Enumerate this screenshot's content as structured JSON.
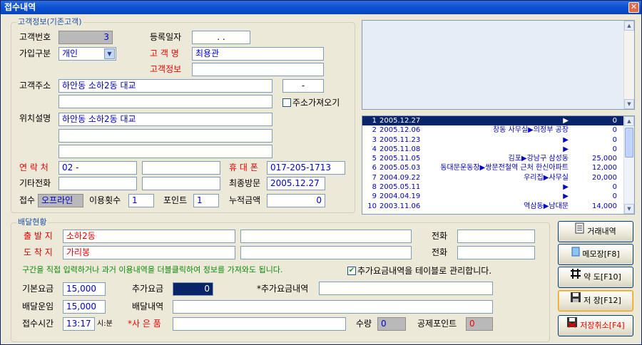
{
  "window": {
    "title": "접수내역",
    "close": "✕"
  },
  "customer": {
    "group_label": "고객정보(기존고객)",
    "id_label": "고객번호",
    "id_value": "3",
    "regdate_label": "등록일자",
    "regdate_value": ". .",
    "type_label": "가입구분",
    "type_value": "개인",
    "name_label": "고 객 명",
    "name_value": "최용관",
    "info_label": "고객정보",
    "info_value": "",
    "address_label": "고객주소",
    "address_value": "하안동 소하2동 대교",
    "zip_value": "-",
    "address2_value": "",
    "fetch_address_label": "주소가져오기",
    "location_label": "위치설명",
    "location_value": "하안동 소하2동 대교",
    "location2_value": "",
    "location3_value": "",
    "contact_label": "연 락 처",
    "contact_value": "02  -",
    "contact2_value": "",
    "mobile_label": "휴 대 폰",
    "mobile_value": "017-205-1713",
    "other_phone_label": "기타전화",
    "other_phone_value": "",
    "other_phone2_value": "",
    "last_visit_label": "최종방문",
    "last_visit_value": "2005.12.27",
    "intake_label": "접수",
    "intake_value": "오프라인",
    "use_count_label": "이용횟수",
    "use_count_value": "1",
    "points_label": "포인트",
    "points_value": "1",
    "total_label": "누적금액",
    "total_value": "0"
  },
  "memo": {
    "value": ""
  },
  "history": {
    "rows": [
      {
        "no": "1",
        "date": "2005.12.27",
        "route": "▶",
        "amount": "0",
        "selected": true
      },
      {
        "no": "2",
        "date": "2005.12.06",
        "route": "창동 사무실▶의정부 공장",
        "amount": "0"
      },
      {
        "no": "3",
        "date": "2005.11.23",
        "route": "▶",
        "amount": "0"
      },
      {
        "no": "4",
        "date": "2005.11.08",
        "route": "▶",
        "amount": "0"
      },
      {
        "no": "5",
        "date": "2005.11.05",
        "route": "김포▶강남구 삼성동",
        "amount": "25,000"
      },
      {
        "no": "6",
        "date": "2005.05.03",
        "route": "동대문운동장▶쌍문전철역 근처 한신아파트",
        "amount": "12,000"
      },
      {
        "no": "7",
        "date": "2004.09.22",
        "route": "우리집▶사무실",
        "amount": "20,000"
      },
      {
        "no": "8",
        "date": "2005.05.11",
        "route": "▶",
        "amount": "0"
      },
      {
        "no": "9",
        "date": "2004.04.19",
        "route": "▶",
        "amount": "0"
      },
      {
        "no": "10",
        "date": "2003.11.06",
        "route": "역삼동▶남대문",
        "amount": "14,000"
      }
    ]
  },
  "delivery": {
    "group_label": "배달현황",
    "origin_label": "출 발 지",
    "origin_value": "소하2동",
    "origin2_value": "",
    "origin_phone_label": "전화",
    "origin_phone_value": "",
    "dest_label": "도 착 지",
    "dest_value": "가리봉",
    "dest2_value": "",
    "dest_phone_label": "전화",
    "dest_phone_value": "",
    "hint": "구간을 직접 입력하거나 과거 이용내역을 더블클릭하여 정보를 가져와도 됩니다.",
    "extra_table_label": "추가요금내역을 테이블로 관리합니다.",
    "base_fee_label": "기본요금",
    "base_fee_value": "15,000",
    "extra_fee_label": "추가요금",
    "extra_fee_value": "0",
    "extra_detail_label": "*추가요금내역",
    "extra_detail_value": "",
    "delivery_fee_label": "배달운임",
    "delivery_fee_value": "15,000",
    "delivery_detail_label": "배달내역",
    "delivery_detail_value": "",
    "time_label": "접수시간",
    "time_value": "13:17",
    "time_unit": "시:분",
    "item_label": "*사 은 품",
    "item_value": "",
    "qty_label": "수량",
    "qty_value": "0",
    "deduct_label": "공제포인트",
    "deduct_value": "0"
  },
  "buttons": {
    "history": "거래내역",
    "memo": "메모장[F8]",
    "map": "약 도[F10]",
    "save": "저 장[F12]",
    "cancel": "저장취소[F4]"
  }
}
